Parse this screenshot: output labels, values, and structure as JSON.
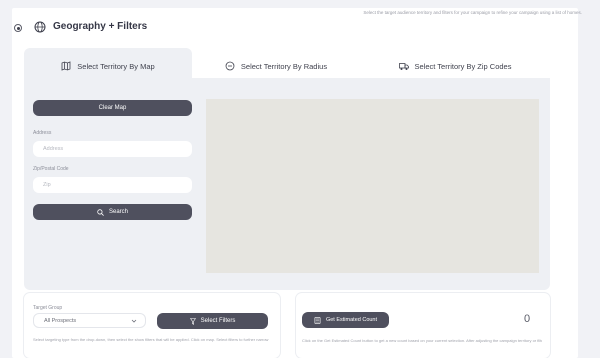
{
  "header": {
    "title": "Geography + Filters",
    "note": "Select the target audience territory and filters for your campaign to refine your campaign using a list of homes."
  },
  "tabs": [
    {
      "label": "Select Territory By Map",
      "icon": "map-icon",
      "active": true
    },
    {
      "label": "Select Territory By Radius",
      "icon": "radius-icon",
      "active": false
    },
    {
      "label": "Select Territory By Zip Codes",
      "icon": "truck-icon",
      "active": false
    }
  ],
  "map_panel": {
    "clear_label": "Clear Map",
    "address_label": "Address",
    "address_placeholder": "Address",
    "zip_label": "Zip/Postal Code",
    "zip_placeholder": "Zip",
    "search_label": "Search"
  },
  "target_group": {
    "label": "Target Group",
    "selected": "All Prospects",
    "filters_label": "Select Filters",
    "note": "Select targeting type from the drop-down, then select the show filters that will be applied. Click on map. Select filters to further narrow possible."
  },
  "count_panel": {
    "button_label": "Get Estimated Count",
    "count": "0",
    "note": "Click on the Get Estimated Count button to get a new count based on your current selection. After adjusting the campaign territory or filters, click again to see the new resulting count."
  },
  "colors": {
    "button": "#4f505e",
    "map": "#e6e5e0",
    "panel_bg": "#eef0f4"
  }
}
